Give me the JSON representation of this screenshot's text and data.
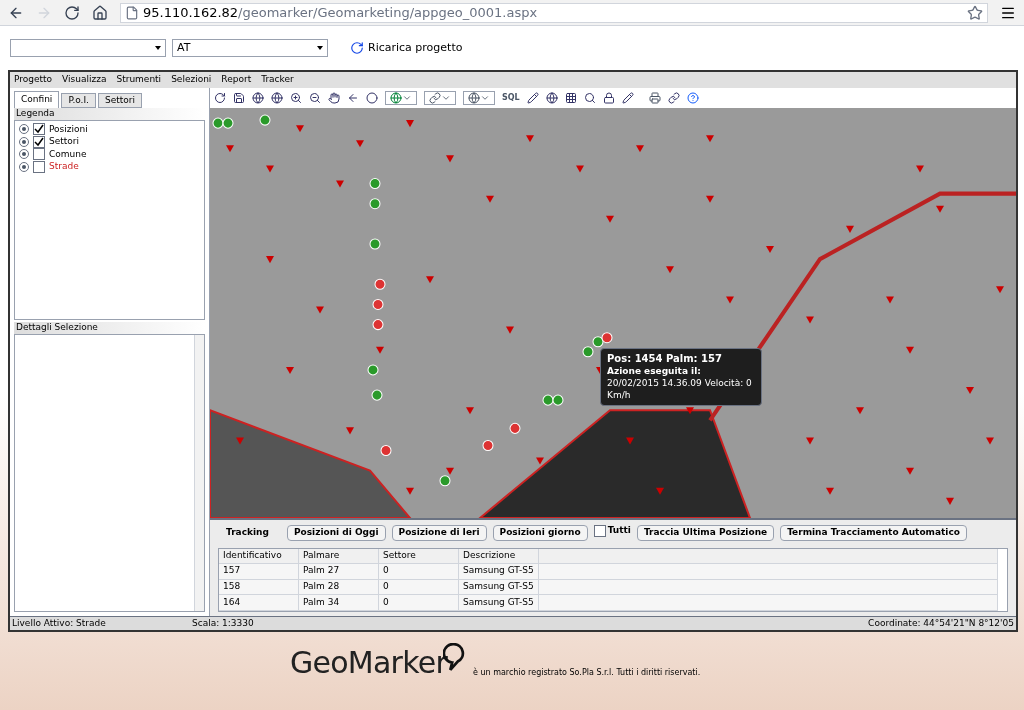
{
  "browser": {
    "url_host": "95.110.162.82",
    "url_path": "/geomarker/Geomarketing/appgeo_0001.aspx"
  },
  "header": {
    "select_2": "AT",
    "reload": "Ricarica progetto"
  },
  "menu": [
    "Progetto",
    "Visualizza",
    "Strumenti",
    "Selezioni",
    "Report",
    "Tracker"
  ],
  "tabs": [
    {
      "label": "Confini",
      "selected": true
    },
    {
      "label": "P.o.I.",
      "selected": false
    },
    {
      "label": "Settori",
      "selected": false
    }
  ],
  "toolbar": {
    "sql": "SQL"
  },
  "legend": {
    "title": "Legenda",
    "items": [
      {
        "label": "Posizioni",
        "checked": true,
        "active": false
      },
      {
        "label": "Settori",
        "checked": true,
        "active": false
      },
      {
        "label": "Comune",
        "checked": false,
        "active": false
      },
      {
        "label": "Strade",
        "checked": false,
        "active": true
      }
    ]
  },
  "details": {
    "title": "Dettagli Selezione"
  },
  "tooltip": {
    "title": "Pos: 1454 Palm: 157",
    "subtitle": "Azione eseguita il:",
    "text": "20/02/2015 14.36.09 Velocità: 0 Km/h"
  },
  "tracking": {
    "label": "Tracking",
    "buttons": [
      "Posizioni di Oggi",
      "Posizione di Ieri",
      "Posizioni giorno"
    ],
    "all": {
      "label": "Tutti",
      "checked": false
    },
    "buttons_2": [
      "Traccia Ultima Posizione",
      "Termina Tracciamento Automatico"
    ],
    "columns": [
      "Identificativo",
      "Palmare",
      "Settore",
      "Descrizione"
    ],
    "rows": [
      [
        "157",
        "Palm 27",
        "0",
        "Samsung GT-S5"
      ],
      [
        "158",
        "Palm 28",
        "0",
        "Samsung GT-S5"
      ],
      [
        "164",
        "Palm 34",
        "0",
        "Samsung GT-S5"
      ]
    ]
  },
  "status_bar": {
    "level": "Livello Attivo: Strade",
    "scale": "Scala: 1:3330",
    "coords": "Coordinate: 44°54'21\"N 8°12'05"
  },
  "footer": {
    "logo": "GeoMarker",
    "text": "è un marchio registrato So.Pla S.r.l. Tutti i diritti riservati."
  }
}
